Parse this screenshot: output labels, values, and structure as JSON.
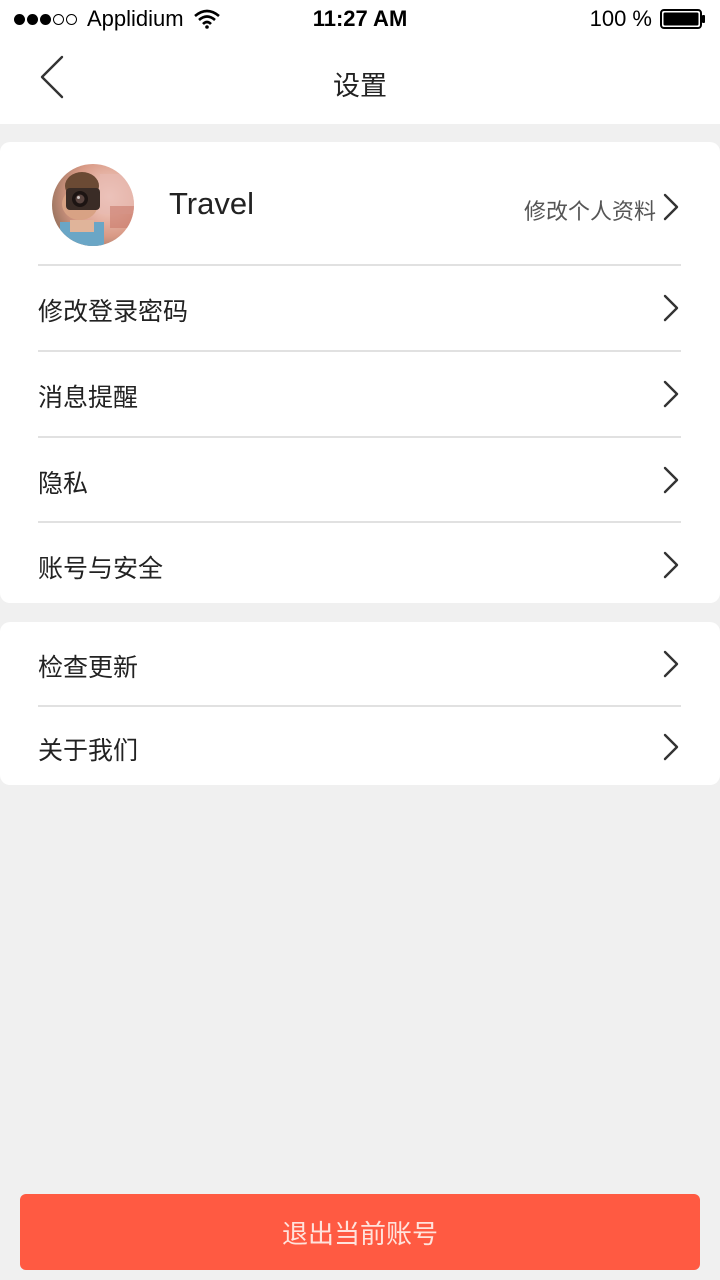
{
  "status_bar": {
    "carrier": "Applidium",
    "time": "11:27 AM",
    "battery": "100 %",
    "signal_filled": 3,
    "signal_total": 5
  },
  "nav": {
    "title": "设置",
    "back_icon": "chevron-left-icon"
  },
  "profile": {
    "name": "Travel",
    "edit_label": "修改个人资料"
  },
  "groups": [
    {
      "items": [
        {
          "label": "修改登录密码"
        },
        {
          "label": "消息提醒"
        },
        {
          "label": "隐私"
        },
        {
          "label": "账号与安全"
        }
      ]
    },
    {
      "items": [
        {
          "label": "检查更新"
        },
        {
          "label": "关于我们"
        }
      ]
    }
  ],
  "logout": {
    "label": "退出当前账号"
  },
  "colors": {
    "background": "#f0f0f0",
    "card": "#ffffff",
    "accent": "#ff5a42",
    "divider": "#e1e1e1"
  }
}
